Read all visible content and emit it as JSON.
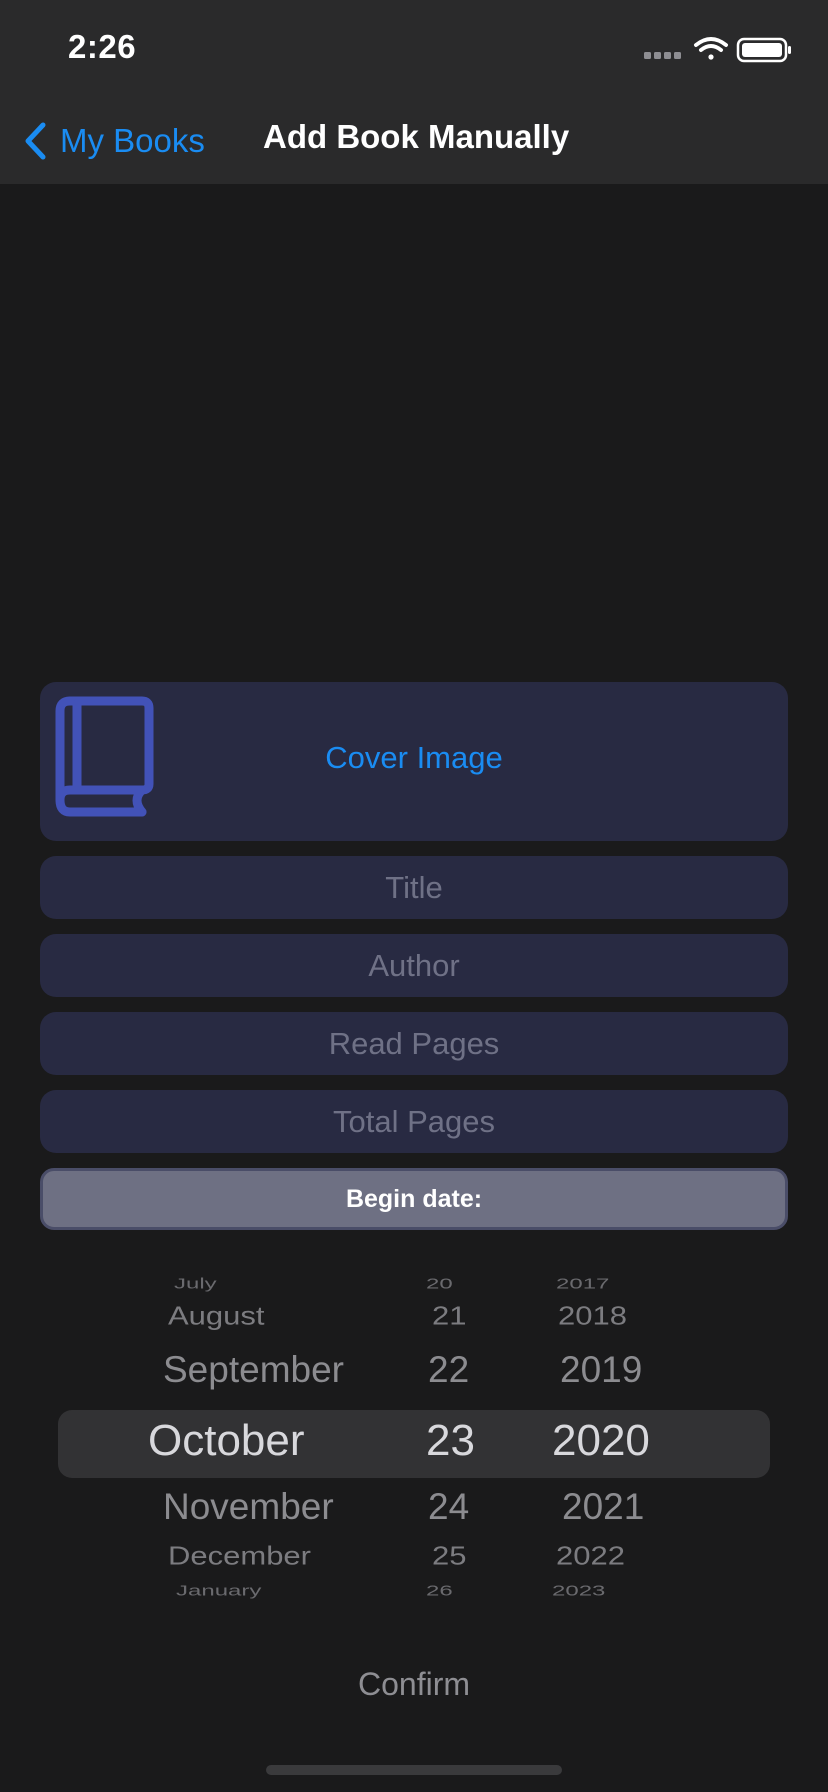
{
  "status_bar": {
    "time": "2:26"
  },
  "nav": {
    "back_label": "My Books",
    "title": "Add Book Manually"
  },
  "form": {
    "cover_image_label": "Cover Image",
    "title_placeholder": "Title",
    "author_placeholder": "Author",
    "read_pages_placeholder": "Read Pages",
    "total_pages_placeholder": "Total Pages",
    "begin_date_label": "Begin date:"
  },
  "date_picker": {
    "months": [
      "July",
      "August",
      "September",
      "October",
      "November",
      "December",
      "January"
    ],
    "days": [
      "20",
      "21",
      "22",
      "23",
      "24",
      "25",
      "26"
    ],
    "years": [
      "2017",
      "2018",
      "2019",
      "2020",
      "2021",
      "2022",
      "2023"
    ],
    "selected": {
      "month": "October",
      "day": "23",
      "year": "2020"
    }
  },
  "confirm_label": "Confirm",
  "icons": {
    "back": "chevron-left-icon",
    "cover": "book-icon",
    "signal": "cellular-signal-icon",
    "wifi": "wifi-icon",
    "battery": "battery-icon"
  },
  "colors": {
    "accent": "#1a8cf2",
    "book_icon": "#4252b8",
    "card_background": "#282a42",
    "begin_date_background": "#6e7083"
  }
}
